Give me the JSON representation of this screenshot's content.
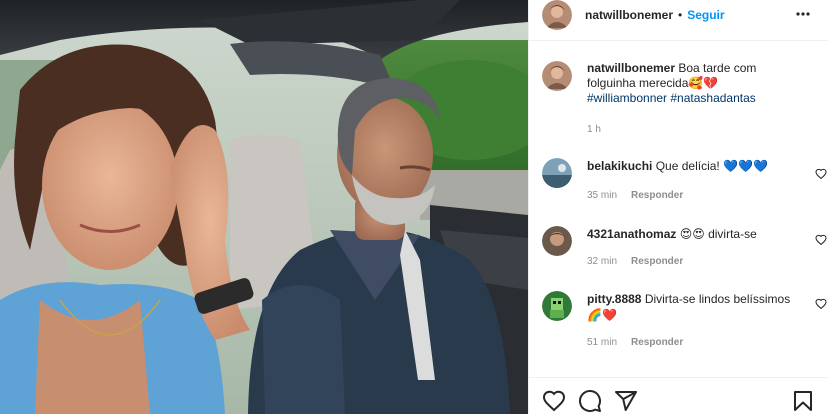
{
  "post": {
    "username": "natwillbonemer",
    "separator": "•",
    "follow_label": "Seguir",
    "caption_text": "Boa tarde com folguinha merecida",
    "caption_emojis": "🥰💔",
    "hashtags": "#williambonner #natashadantas",
    "caption_time": "1 h"
  },
  "comments": [
    {
      "username": "belakikuchi",
      "text": "Que delícia!",
      "emojis": "💙💙💙",
      "time": "35 min",
      "reply_label": "Responder"
    },
    {
      "username": "4321anathomaz",
      "text": "divirta-se",
      "emojis_before": "😍😍",
      "time": "32 min",
      "reply_label": "Responder"
    },
    {
      "username": "pitty.8888",
      "text": "Divirta-se lindos belíssimos",
      "emojis": "🌈❤️",
      "time": "51 min",
      "reply_label": "Responder"
    }
  ],
  "icons": {
    "more": "more-options-icon",
    "like": "heart-icon",
    "comment": "comment-icon",
    "share": "share-icon",
    "save": "bookmark-icon"
  },
  "colors": {
    "follow": "#0095f6",
    "hashtag": "#00376b",
    "muted": "#8e8e8e",
    "heart": "#ed4956",
    "blue_heart": "#2f6fd1"
  }
}
